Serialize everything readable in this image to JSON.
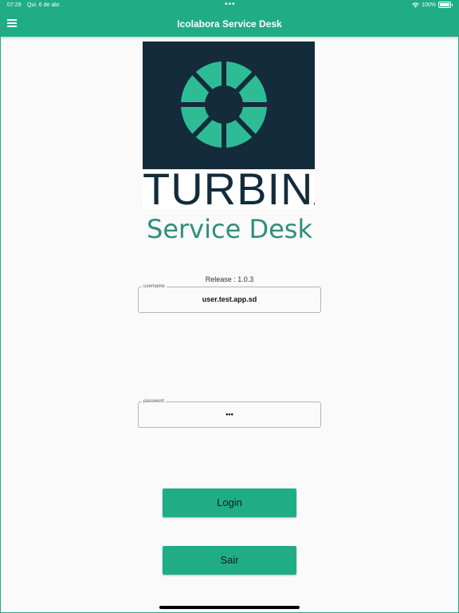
{
  "status_bar": {
    "time": "07:29",
    "date": "Qui. 6 de abr.",
    "battery": "100%"
  },
  "app_bar": {
    "title": "Icolabora Service Desk"
  },
  "logo": {
    "word": "TURBINA",
    "colors": {
      "background": "#132b3a",
      "segments": "#2ebc96"
    }
  },
  "subtitle": "Service Desk",
  "release": "Release : 1.0.3",
  "form": {
    "username": {
      "label": "username",
      "value": "user.test.app.sd"
    },
    "password": {
      "label": "password",
      "value": "•••"
    }
  },
  "buttons": {
    "login": "Login",
    "exit": "Sair"
  },
  "colors": {
    "accent": "#20ad86"
  }
}
